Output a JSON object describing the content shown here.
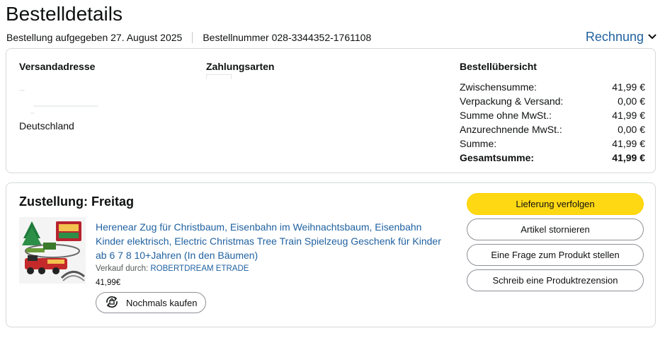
{
  "header": {
    "title": "Bestelldetails",
    "order_date_label": "Bestellung aufgegeben 27. August 2025",
    "order_number_label": "Bestellnummer 028-3344352-1761108",
    "invoice_label": "Rechnung"
  },
  "summary_card": {
    "shipping_heading": "Versandadresse",
    "shipping_country": "Deutschland",
    "payment_heading": "Zahlungsarten",
    "overview_heading": "Bestellübersicht",
    "rows": [
      {
        "label": "Zwischensumme:",
        "value": "41,99 €"
      },
      {
        "label": "Verpackung & Versand:",
        "value": "0,00 €"
      },
      {
        "label": "Summe ohne MwSt.:",
        "value": "41,99 €"
      },
      {
        "label": "Anzurechnende MwSt.:",
        "value": "0,00 €"
      },
      {
        "label": "Summe:",
        "value": "41,99 €"
      },
      {
        "label": "Gesamtsumme:",
        "value": "41,99 €"
      }
    ]
  },
  "delivery": {
    "heading": "Zustellung: Freitag",
    "product_title": "Herenear Zug für Christbaum, Eisenbahn im Weihnachtsbaum, Eisenbahn Kinder elektrisch, Electric Christmas Tree Train Spielzeug Geschenk für Kinder ab 6 7 8 10+Jahren (In den Bäumen)",
    "seller_prefix": "Verkauf durch: ",
    "seller_name": "ROBERTDREAM ETRADE",
    "price": "41,99€",
    "rebuy_label": "Nochmals kaufen",
    "buttons": {
      "track": "Lieferung verfolgen",
      "cancel": "Artikel stornieren",
      "question": "Eine Frage zum Produkt stellen",
      "review": "Schreib eine Produktrezension"
    }
  },
  "colors": {
    "link": "#2162a1",
    "primary_button": "#ffd814",
    "border": "#d5d9d9"
  }
}
